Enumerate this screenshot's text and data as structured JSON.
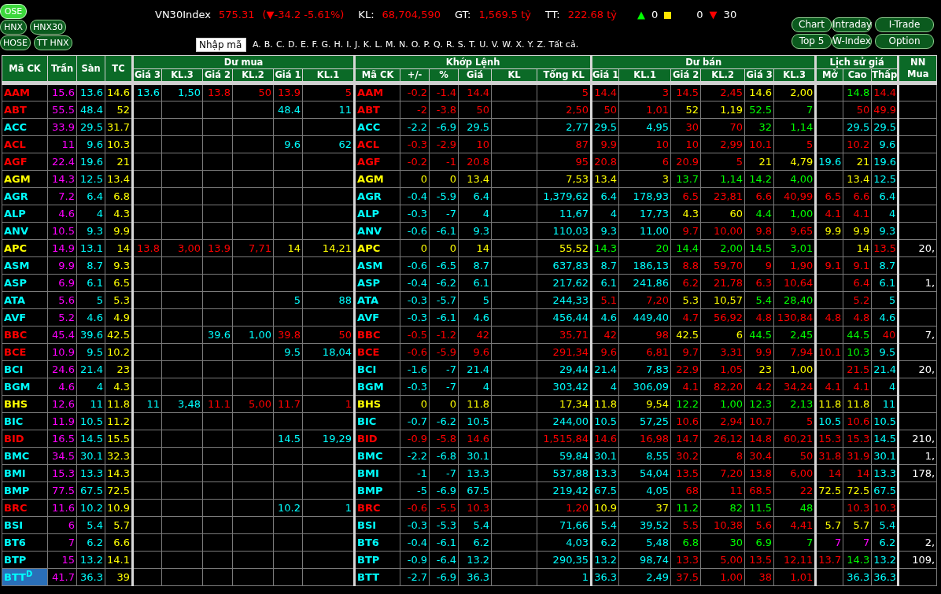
{
  "markets": [
    [
      {
        "label": "OSE",
        "selected": true
      }
    ],
    [
      {
        "label": "HNX",
        "selected": false
      },
      {
        "label": "HNX30",
        "selected": false
      }
    ],
    [
      {
        "label": "HOSE",
        "selected": false
      },
      {
        "label": "TT HNX",
        "selected": false
      }
    ]
  ],
  "index": {
    "name": "VN30Index",
    "value": "575.31",
    "change": "(▼-34.2  -5.61%)",
    "color": "#ff0000",
    "stats": [
      {
        "label": "KL:",
        "value": "68,704,590"
      },
      {
        "label": "GT:",
        "value": "1,569.5 tỷ"
      },
      {
        "label": "TT:",
        "value": "222.68 tỷ"
      }
    ],
    "breadth": [
      {
        "kind": "up",
        "symbol": "▲",
        "count": "0"
      },
      {
        "kind": "unchanged",
        "count": "0"
      },
      {
        "kind": "down",
        "symbol": "▼",
        "count": "30"
      }
    ]
  },
  "search": {
    "placeholder": "Nhập mã",
    "letters": [
      "A.",
      "B.",
      "C.",
      "D.",
      "E.",
      "F.",
      "G.",
      "H.",
      "I.",
      "J.",
      "K.",
      "L.",
      "M.",
      "N.",
      "O.",
      "P.",
      "Q.",
      "R.",
      "S.",
      "T.",
      "U.",
      "V.",
      "W.",
      "X.",
      "Y.",
      "Z.",
      "Tất cả."
    ]
  },
  "tools": [
    [
      "Chart",
      "Intraday",
      "I-Trade"
    ],
    [
      "Top 5",
      "W-Index",
      "Option"
    ]
  ],
  "table": {
    "lead_columns": [
      "Mã CK",
      "Trần",
      "Sàn",
      "TC"
    ],
    "groups": [
      {
        "title": "Dư mua",
        "columns": [
          "Giá 3",
          "KL.3",
          "Giá 2",
          "KL.2",
          "Giá 1",
          "KL.1"
        ]
      },
      {
        "title": "Khớp Lệnh",
        "columns": [
          "Mã CK",
          "+/-",
          "%",
          "Giá",
          "KL",
          "Tổng KL"
        ]
      },
      {
        "title": "Dư bán",
        "columns": [
          "Giá 1",
          "KL.1",
          "Giá 2",
          "KL.2",
          "Giá 3",
          "KL.3"
        ]
      },
      {
        "title": "Lịch sử giá",
        "columns": [
          "Mở",
          "Cao",
          "Thấp"
        ]
      }
    ],
    "tail_column": "NN Mua",
    "rows": [
      {
        "symbol": "AAM",
        "color": "#ff0000",
        "selected": false,
        "ceiling": "15.6",
        "floor": "13.6",
        "reference": "14.6",
        "bid3": {
          "price": "13.6",
          "volume": "1,50",
          "color": "#00ffff"
        },
        "bid2": {
          "price": "13.8",
          "volume": "50",
          "color": "#ff0000"
        },
        "bid1": {
          "price": "13.9",
          "volume": "5",
          "color": "#ff0000"
        },
        "match_symbol": "AAM",
        "change": "-0.2",
        "percent": "-1.4",
        "price": "14.4",
        "total": "5",
        "ask1": {
          "price": "14.4",
          "volume": "3",
          "color": "#ff0000"
        },
        "ask2": {
          "price": "14.5",
          "volume": "2,45",
          "color": "#ff0000"
        },
        "ask3": {
          "price": "14.6",
          "volume": "2,00",
          "color": "#ffff00"
        },
        "high": {
          "text": "14.8",
          "color": "#00ff00"
        },
        "low": {
          "text": "14.4",
          "color": "#ff0000"
        }
      },
      {
        "symbol": "ABT",
        "color": "#ff0000",
        "selected": false,
        "ceiling": "55.5",
        "floor": "48.4",
        "reference": "52",
        "bid1": {
          "price": "48.4",
          "volume": "11",
          "color": "#00ffff"
        },
        "match_symbol": "ABT",
        "change": "-2",
        "percent": "-3.8",
        "price": "50",
        "total": "2,50",
        "ask1": {
          "price": "50",
          "volume": "1,01",
          "color": "#ff0000"
        },
        "ask2": {
          "price": "52",
          "volume": "1,19",
          "color": "#ffff00"
        },
        "ask3": {
          "price": "52.5",
          "volume": "7",
          "color": "#00ff00"
        },
        "high": {
          "text": "50",
          "color": "#ff0000"
        },
        "low": {
          "text": "49.9",
          "color": "#ff0000"
        }
      },
      {
        "symbol": "ACC",
        "color": "#00ffff",
        "selected": false,
        "ceiling": "33.9",
        "floor": "29.5",
        "reference": "31.7",
        "match_symbol": "ACC",
        "change": "-2.2",
        "percent": "-6.9",
        "price": "29.5",
        "total": "2,77",
        "ask1": {
          "price": "29.5",
          "volume": "4,95",
          "color": "#00ffff"
        },
        "ask2": {
          "price": "30",
          "volume": "70",
          "color": "#ff0000"
        },
        "ask3": {
          "price": "32",
          "volume": "1,14",
          "color": "#00ff00"
        },
        "high": {
          "text": "29.5",
          "color": "#00ffff"
        },
        "low": {
          "text": "29.5",
          "color": "#00ffff"
        }
      },
      {
        "symbol": "ACL",
        "color": "#ff0000",
        "selected": false,
        "ceiling": "11",
        "floor": "9.6",
        "reference": "10.3",
        "bid1": {
          "price": "9.6",
          "volume": "62",
          "color": "#00ffff"
        },
        "match_symbol": "ACL",
        "change": "-0.3",
        "percent": "-2.9",
        "price": "10",
        "total": "87",
        "ask1": {
          "price": "9.9",
          "volume": "10",
          "color": "#ff0000"
        },
        "ask2": {
          "price": "10",
          "volume": "2,99",
          "color": "#ff0000"
        },
        "ask3": {
          "price": "10.1",
          "volume": "5",
          "color": "#ff0000"
        },
        "high": {
          "text": "10.2",
          "color": "#ff0000"
        },
        "low": {
          "text": "9.6",
          "color": "#00ffff"
        }
      },
      {
        "symbol": "AGF",
        "color": "#ff0000",
        "selected": false,
        "ceiling": "22.4",
        "floor": "19.6",
        "reference": "21",
        "match_symbol": "AGF",
        "change": "-0.2",
        "percent": "-1",
        "price": "20.8",
        "total": "95",
        "ask1": {
          "price": "20.8",
          "volume": "6",
          "color": "#ff0000"
        },
        "ask2": {
          "price": "20.9",
          "volume": "5",
          "color": "#ff0000"
        },
        "ask3": {
          "price": "21",
          "volume": "4,79",
          "color": "#ffff00"
        },
        "open": {
          "text": "19.6",
          "color": "#00ffff"
        },
        "high": {
          "text": "21",
          "color": "#ffff00"
        },
        "low": {
          "text": "19.6",
          "color": "#00ffff"
        }
      },
      {
        "symbol": "AGM",
        "color": "#ffff00",
        "selected": false,
        "ceiling": "14.3",
        "floor": "12.5",
        "reference": "13.4",
        "match_symbol": "AGM",
        "change": "0",
        "percent": "0",
        "price": "13.4",
        "total": "7,53",
        "ask1": {
          "price": "13.4",
          "volume": "3",
          "color": "#ffff00"
        },
        "ask2": {
          "price": "13.7",
          "volume": "1,14",
          "color": "#00ff00"
        },
        "ask3": {
          "price": "14.2",
          "volume": "4,00",
          "color": "#00ff00"
        },
        "high": {
          "text": "13.4",
          "color": "#ffff00"
        },
        "low": {
          "text": "12.5",
          "color": "#00ffff"
        }
      },
      {
        "symbol": "AGR",
        "color": "#00ffff",
        "selected": false,
        "ceiling": "7.2",
        "floor": "6.4",
        "reference": "6.8",
        "match_symbol": "AGR",
        "change": "-0.4",
        "percent": "-5.9",
        "price": "6.4",
        "total": "1,379,62",
        "ask1": {
          "price": "6.4",
          "volume": "178,93",
          "color": "#00ffff"
        },
        "ask2": {
          "price": "6.5",
          "volume": "23,81",
          "color": "#ff0000"
        },
        "ask3": {
          "price": "6.6",
          "volume": "40,99",
          "color": "#ff0000"
        },
        "open": {
          "text": "6.5",
          "color": "#ff0000"
        },
        "high": {
          "text": "6.6",
          "color": "#ff0000"
        },
        "low": {
          "text": "6.4",
          "color": "#00ffff"
        }
      },
      {
        "symbol": "ALP",
        "color": "#00ffff",
        "selected": false,
        "ceiling": "4.6",
        "floor": "4",
        "reference": "4.3",
        "match_symbol": "ALP",
        "change": "-0.3",
        "percent": "-7",
        "price": "4",
        "total": "11,67",
        "ask1": {
          "price": "4",
          "volume": "17,73",
          "color": "#00ffff"
        },
        "ask2": {
          "price": "4.3",
          "volume": "60",
          "color": "#ffff00"
        },
        "ask3": {
          "price": "4.4",
          "volume": "1,00",
          "color": "#00ff00"
        },
        "open": {
          "text": "4.1",
          "color": "#ff0000"
        },
        "high": {
          "text": "4.1",
          "color": "#ff0000"
        },
        "low": {
          "text": "4",
          "color": "#00ffff"
        }
      },
      {
        "symbol": "ANV",
        "color": "#00ffff",
        "selected": false,
        "ceiling": "10.5",
        "floor": "9.3",
        "reference": "9.9",
        "match_symbol": "ANV",
        "change": "-0.6",
        "percent": "-6.1",
        "price": "9.3",
        "total": "110,03",
        "ask1": {
          "price": "9.3",
          "volume": "11,00",
          "color": "#00ffff"
        },
        "ask2": {
          "price": "9.7",
          "volume": "10,00",
          "color": "#ff0000"
        },
        "ask3": {
          "price": "9.8",
          "volume": "9,65",
          "color": "#ff0000"
        },
        "open": {
          "text": "9.9",
          "color": "#ffff00"
        },
        "high": {
          "text": "9.9",
          "color": "#ffff00"
        },
        "low": {
          "text": "9.3",
          "color": "#00ffff"
        }
      },
      {
        "symbol": "APC",
        "color": "#ffff00",
        "selected": false,
        "ceiling": "14.9",
        "floor": "13.1",
        "reference": "14",
        "bid3": {
          "price": "13.8",
          "volume": "3,00",
          "color": "#ff0000"
        },
        "bid2": {
          "price": "13.9",
          "volume": "7,71",
          "color": "#ff0000"
        },
        "bid1": {
          "price": "14",
          "volume": "14,21",
          "color": "#ffff00"
        },
        "match_symbol": "APC",
        "change": "0",
        "percent": "0",
        "price": "14",
        "total": "55,52",
        "ask1": {
          "price": "14.3",
          "volume": "20",
          "color": "#00ff00"
        },
        "ask2": {
          "price": "14.4",
          "volume": "2,00",
          "color": "#00ff00"
        },
        "ask3": {
          "price": "14.5",
          "volume": "3,01",
          "color": "#00ff00"
        },
        "high": {
          "text": "14",
          "color": "#ffff00"
        },
        "low": {
          "text": "13.5",
          "color": "#ff0000"
        },
        "foreign_buy": "20,"
      },
      {
        "symbol": "ASM",
        "color": "#00ffff",
        "selected": false,
        "ceiling": "9.9",
        "floor": "8.7",
        "reference": "9.3",
        "match_symbol": "ASM",
        "change": "-0.6",
        "percent": "-6.5",
        "price": "8.7",
        "total": "637,83",
        "ask1": {
          "price": "8.7",
          "volume": "186,13",
          "color": "#00ffff"
        },
        "ask2": {
          "price": "8.8",
          "volume": "59,70",
          "color": "#ff0000"
        },
        "ask3": {
          "price": "9",
          "volume": "1,90",
          "color": "#ff0000"
        },
        "open": {
          "text": "9.1",
          "color": "#ff0000"
        },
        "high": {
          "text": "9.1",
          "color": "#ff0000"
        },
        "low": {
          "text": "8.7",
          "color": "#00ffff"
        }
      },
      {
        "symbol": "ASP",
        "color": "#00ffff",
        "selected": false,
        "ceiling": "6.9",
        "floor": "6.1",
        "reference": "6.5",
        "match_symbol": "ASP",
        "change": "-0.4",
        "percent": "-6.2",
        "price": "6.1",
        "total": "217,62",
        "ask1": {
          "price": "6.1",
          "volume": "241,86",
          "color": "#00ffff"
        },
        "ask2": {
          "price": "6.2",
          "volume": "21,78",
          "color": "#ff0000"
        },
        "ask3": {
          "price": "6.3",
          "volume": "10,64",
          "color": "#ff0000"
        },
        "high": {
          "text": "6.4",
          "color": "#ff0000"
        },
        "low": {
          "text": "6.1",
          "color": "#00ffff"
        },
        "foreign_buy": "1,"
      },
      {
        "symbol": "ATA",
        "color": "#00ffff",
        "selected": false,
        "ceiling": "5.6",
        "floor": "5",
        "reference": "5.3",
        "bid1": {
          "price": "5",
          "volume": "88",
          "color": "#00ffff"
        },
        "match_symbol": "ATA",
        "change": "-0.3",
        "percent": "-5.7",
        "price": "5",
        "total": "244,33",
        "ask1": {
          "price": "5.1",
          "volume": "7,20",
          "color": "#ff0000"
        },
        "ask2": {
          "price": "5.3",
          "volume": "10,57",
          "color": "#ffff00"
        },
        "ask3": {
          "price": "5.4",
          "volume": "28,40",
          "color": "#00ff00"
        },
        "high": {
          "text": "5.2",
          "color": "#ff0000"
        },
        "low": {
          "text": "5",
          "color": "#00ffff"
        }
      },
      {
        "symbol": "AVF",
        "color": "#00ffff",
        "selected": false,
        "ceiling": "5.2",
        "floor": "4.6",
        "reference": "4.9",
        "match_symbol": "AVF",
        "change": "-0.3",
        "percent": "-6.1",
        "price": "4.6",
        "total": "456,44",
        "ask1": {
          "price": "4.6",
          "volume": "449,40",
          "color": "#00ffff"
        },
        "ask2": {
          "price": "4.7",
          "volume": "56,92",
          "color": "#ff0000"
        },
        "ask3": {
          "price": "4.8",
          "volume": "130,84",
          "color": "#ff0000"
        },
        "open": {
          "text": "4.8",
          "color": "#ff0000"
        },
        "high": {
          "text": "4.8",
          "color": "#ff0000"
        },
        "low": {
          "text": "4.6",
          "color": "#00ffff"
        }
      },
      {
        "symbol": "BBC",
        "color": "#ff0000",
        "selected": false,
        "ceiling": "45.4",
        "floor": "39.6",
        "reference": "42.5",
        "bid2": {
          "price": "39.6",
          "volume": "1,00",
          "color": "#00ffff"
        },
        "bid1": {
          "price": "39.8",
          "volume": "50",
          "color": "#ff0000"
        },
        "match_symbol": "BBC",
        "change": "-0.5",
        "percent": "-1.2",
        "price": "42",
        "total": "35,71",
        "ask1": {
          "price": "42",
          "volume": "98",
          "color": "#ff0000"
        },
        "ask2": {
          "price": "42.5",
          "volume": "6",
          "color": "#ffff00"
        },
        "ask3": {
          "price": "44.5",
          "volume": "2,45",
          "color": "#00ff00"
        },
        "high": {
          "text": "44.5",
          "color": "#00ff00"
        },
        "low": {
          "text": "40",
          "color": "#ff0000"
        },
        "foreign_buy": "7,"
      },
      {
        "symbol": "BCE",
        "color": "#ff0000",
        "selected": false,
        "ceiling": "10.9",
        "floor": "9.5",
        "reference": "10.2",
        "bid1": {
          "price": "9.5",
          "volume": "18,04",
          "color": "#00ffff"
        },
        "match_symbol": "BCE",
        "change": "-0.6",
        "percent": "-5.9",
        "price": "9.6",
        "total": "291,34",
        "ask1": {
          "price": "9.6",
          "volume": "6,81",
          "color": "#ff0000"
        },
        "ask2": {
          "price": "9.7",
          "volume": "3,31",
          "color": "#ff0000"
        },
        "ask3": {
          "price": "9.9",
          "volume": "7,94",
          "color": "#ff0000"
        },
        "open": {
          "text": "10.1",
          "color": "#ff0000"
        },
        "high": {
          "text": "10.3",
          "color": "#00ff00"
        },
        "low": {
          "text": "9.5",
          "color": "#00ffff"
        }
      },
      {
        "symbol": "BCI",
        "color": "#00ffff",
        "selected": false,
        "ceiling": "24.6",
        "floor": "21.4",
        "reference": "23",
        "match_symbol": "BCI",
        "change": "-1.6",
        "percent": "-7",
        "price": "21.4",
        "total": "29,44",
        "ask1": {
          "price": "21.4",
          "volume": "7,83",
          "color": "#00ffff"
        },
        "ask2": {
          "price": "22.9",
          "volume": "1,05",
          "color": "#ff0000"
        },
        "ask3": {
          "price": "23",
          "volume": "1,00",
          "color": "#ffff00"
        },
        "high": {
          "text": "21.5",
          "color": "#ff0000"
        },
        "low": {
          "text": "21.4",
          "color": "#00ffff"
        },
        "foreign_buy": "20,"
      },
      {
        "symbol": "BGM",
        "color": "#00ffff",
        "selected": false,
        "ceiling": "4.6",
        "floor": "4",
        "reference": "4.3",
        "match_symbol": "BGM",
        "change": "-0.3",
        "percent": "-7",
        "price": "4",
        "total": "303,42",
        "ask1": {
          "price": "4",
          "volume": "306,09",
          "color": "#00ffff"
        },
        "ask2": {
          "price": "4.1",
          "volume": "82,20",
          "color": "#ff0000"
        },
        "ask3": {
          "price": "4.2",
          "volume": "34,24",
          "color": "#ff0000"
        },
        "open": {
          "text": "4.1",
          "color": "#ff0000"
        },
        "high": {
          "text": "4.1",
          "color": "#ff0000"
        },
        "low": {
          "text": "4",
          "color": "#00ffff"
        }
      },
      {
        "symbol": "BHS",
        "color": "#ffff00",
        "selected": false,
        "ceiling": "12.6",
        "floor": "11",
        "reference": "11.8",
        "bid3": {
          "price": "11",
          "volume": "3,48",
          "color": "#00ffff"
        },
        "bid2": {
          "price": "11.1",
          "volume": "5,00",
          "color": "#ff0000"
        },
        "bid1": {
          "price": "11.7",
          "volume": "1",
          "color": "#ff0000"
        },
        "match_symbol": "BHS",
        "change": "0",
        "percent": "0",
        "price": "11.8",
        "total": "17,34",
        "ask1": {
          "price": "11.8",
          "volume": "9,54",
          "color": "#ffff00"
        },
        "ask2": {
          "price": "12.2",
          "volume": "1,00",
          "color": "#00ff00"
        },
        "ask3": {
          "price": "12.3",
          "volume": "2,13",
          "color": "#00ff00"
        },
        "open": {
          "text": "11.8",
          "color": "#ffff00"
        },
        "high": {
          "text": "11.8",
          "color": "#ffff00"
        },
        "low": {
          "text": "11",
          "color": "#00ffff"
        }
      },
      {
        "symbol": "BIC",
        "color": "#00ffff",
        "selected": false,
        "ceiling": "11.9",
        "floor": "10.5",
        "reference": "11.2",
        "match_symbol": "BIC",
        "change": "-0.7",
        "percent": "-6.2",
        "price": "10.5",
        "total": "244,00",
        "ask1": {
          "price": "10.5",
          "volume": "57,25",
          "color": "#00ffff"
        },
        "ask2": {
          "price": "10.6",
          "volume": "2,94",
          "color": "#ff0000"
        },
        "ask3": {
          "price": "10.7",
          "volume": "5",
          "color": "#ff0000"
        },
        "open": {
          "text": "10.5",
          "color": "#00ffff"
        },
        "high": {
          "text": "10.6",
          "color": "#ff0000"
        },
        "low": {
          "text": "10.5",
          "color": "#00ffff"
        }
      },
      {
        "symbol": "BID",
        "color": "#ff0000",
        "selected": false,
        "ceiling": "16.5",
        "floor": "14.5",
        "reference": "15.5",
        "bid1": {
          "price": "14.5",
          "volume": "19,29",
          "color": "#00ffff"
        },
        "match_symbol": "BID",
        "change": "-0.9",
        "percent": "-5.8",
        "price": "14.6",
        "total": "1,515,84",
        "ask1": {
          "price": "14.6",
          "volume": "16,98",
          "color": "#ff0000"
        },
        "ask2": {
          "price": "14.7",
          "volume": "26,12",
          "color": "#ff0000"
        },
        "ask3": {
          "price": "14.8",
          "volume": "60,21",
          "color": "#ff0000"
        },
        "open": {
          "text": "15.3",
          "color": "#ff0000"
        },
        "high": {
          "text": "15.3",
          "color": "#ff0000"
        },
        "low": {
          "text": "14.5",
          "color": "#00ffff"
        },
        "foreign_buy": "210,"
      },
      {
        "symbol": "BMC",
        "color": "#00ffff",
        "selected": false,
        "ceiling": "34.5",
        "floor": "30.1",
        "reference": "32.3",
        "match_symbol": "BMC",
        "change": "-2.2",
        "percent": "-6.8",
        "price": "30.1",
        "total": "59,84",
        "ask1": {
          "price": "30.1",
          "volume": "8,55",
          "color": "#00ffff"
        },
        "ask2": {
          "price": "30.2",
          "volume": "8",
          "color": "#ff0000"
        },
        "ask3": {
          "price": "30.4",
          "volume": "50",
          "color": "#ff0000"
        },
        "open": {
          "text": "31.8",
          "color": "#ff0000"
        },
        "high": {
          "text": "31.9",
          "color": "#ff0000"
        },
        "low": {
          "text": "30.1",
          "color": "#00ffff"
        },
        "foreign_buy": "1,"
      },
      {
        "symbol": "BMI",
        "color": "#00ffff",
        "selected": false,
        "ceiling": "15.3",
        "floor": "13.3",
        "reference": "14.3",
        "match_symbol": "BMI",
        "change": "-1",
        "percent": "-7",
        "price": "13.3",
        "total": "537,88",
        "ask1": {
          "price": "13.3",
          "volume": "54,04",
          "color": "#00ffff"
        },
        "ask2": {
          "price": "13.5",
          "volume": "7,20",
          "color": "#ff0000"
        },
        "ask3": {
          "price": "13.8",
          "volume": "6,00",
          "color": "#ff0000"
        },
        "open": {
          "text": "14",
          "color": "#ff0000"
        },
        "high": {
          "text": "14",
          "color": "#ff0000"
        },
        "low": {
          "text": "13.3",
          "color": "#00ffff"
        },
        "foreign_buy": "178,"
      },
      {
        "symbol": "BMP",
        "color": "#00ffff",
        "selected": false,
        "ceiling": "77.5",
        "floor": "67.5",
        "reference": "72.5",
        "match_symbol": "BMP",
        "change": "-5",
        "percent": "-6.9",
        "price": "67.5",
        "total": "219,42",
        "ask1": {
          "price": "67.5",
          "volume": "4,05",
          "color": "#00ffff"
        },
        "ask2": {
          "price": "68",
          "volume": "11",
          "color": "#ff0000"
        },
        "ask3": {
          "price": "68.5",
          "volume": "22",
          "color": "#ff0000"
        },
        "open": {
          "text": "72.5",
          "color": "#ffff00"
        },
        "high": {
          "text": "72.5",
          "color": "#ffff00"
        },
        "low": {
          "text": "67.5",
          "color": "#00ffff"
        }
      },
      {
        "symbol": "BRC",
        "color": "#ff0000",
        "selected": false,
        "ceiling": "11.6",
        "floor": "10.2",
        "reference": "10.9",
        "bid1": {
          "price": "10.2",
          "volume": "1",
          "color": "#00ffff"
        },
        "match_symbol": "BRC",
        "change": "-0.6",
        "percent": "-5.5",
        "price": "10.3",
        "total": "1,20",
        "ask1": {
          "price": "10.9",
          "volume": "37",
          "color": "#ffff00"
        },
        "ask2": {
          "price": "11.2",
          "volume": "82",
          "color": "#00ff00"
        },
        "ask3": {
          "price": "11.5",
          "volume": "48",
          "color": "#00ff00"
        },
        "high": {
          "text": "10.3",
          "color": "#ff0000"
        },
        "low": {
          "text": "10.3",
          "color": "#ff0000"
        }
      },
      {
        "symbol": "BSI",
        "color": "#00ffff",
        "selected": false,
        "ceiling": "6",
        "floor": "5.4",
        "reference": "5.7",
        "match_symbol": "BSI",
        "change": "-0.3",
        "percent": "-5.3",
        "price": "5.4",
        "total": "71,66",
        "ask1": {
          "price": "5.4",
          "volume": "39,52",
          "color": "#00ffff"
        },
        "ask2": {
          "price": "5.5",
          "volume": "10,38",
          "color": "#ff0000"
        },
        "ask3": {
          "price": "5.6",
          "volume": "4,41",
          "color": "#ff0000"
        },
        "open": {
          "text": "5.7",
          "color": "#ffff00"
        },
        "high": {
          "text": "5.7",
          "color": "#ffff00"
        },
        "low": {
          "text": "5.4",
          "color": "#00ffff"
        }
      },
      {
        "symbol": "BT6",
        "color": "#00ffff",
        "selected": false,
        "ceiling": "7",
        "floor": "6.2",
        "reference": "6.6",
        "match_symbol": "BT6",
        "change": "-0.4",
        "percent": "-6.1",
        "price": "6.2",
        "total": "4,03",
        "ask1": {
          "price": "6.2",
          "volume": "5,48",
          "color": "#00ffff"
        },
        "ask2": {
          "price": "6.8",
          "volume": "30",
          "color": "#00ff00"
        },
        "ask3": {
          "price": "6.9",
          "volume": "7",
          "color": "#00ff00"
        },
        "open": {
          "text": "7",
          "color": "#ff00ff"
        },
        "high": {
          "text": "7",
          "color": "#ff00ff"
        },
        "low": {
          "text": "6.2",
          "color": "#00ffff"
        },
        "foreign_buy": "2,"
      },
      {
        "symbol": "BTP",
        "color": "#00ffff",
        "selected": false,
        "ceiling": "15",
        "floor": "13.2",
        "reference": "14.1",
        "match_symbol": "BTP",
        "change": "-0.9",
        "percent": "-6.4",
        "price": "13.2",
        "total": "290,35",
        "ask1": {
          "price": "13.2",
          "volume": "98,74",
          "color": "#00ffff"
        },
        "ask2": {
          "price": "13.3",
          "volume": "5,00",
          "color": "#ff0000"
        },
        "ask3": {
          "price": "13.5",
          "volume": "12,11",
          "color": "#ff0000"
        },
        "open": {
          "text": "13.7",
          "color": "#ff0000"
        },
        "high": {
          "text": "14.3",
          "color": "#00ff00"
        },
        "low": {
          "text": "13.2",
          "color": "#00ffff"
        },
        "foreign_buy": "109,"
      },
      {
        "symbol": "BTT",
        "note": "D",
        "color": "#00ffff",
        "selected": true,
        "ceiling": "41.7",
        "floor": "36.3",
        "reference": "39",
        "match_symbol": "BTT",
        "change": "-2.7",
        "percent": "-6.9",
        "price": "36.3",
        "total": "1",
        "ask1": {
          "price": "36.3",
          "volume": "2,49",
          "color": "#00ffff"
        },
        "ask2": {
          "price": "37.5",
          "volume": "1,00",
          "color": "#ff0000"
        },
        "ask3": {
          "price": "38",
          "volume": "1,01",
          "color": "#ff0000"
        },
        "high": {
          "text": "36.3",
          "color": "#00ffff"
        },
        "low": {
          "text": "36.3",
          "color": "#00ffff"
        }
      }
    ]
  }
}
